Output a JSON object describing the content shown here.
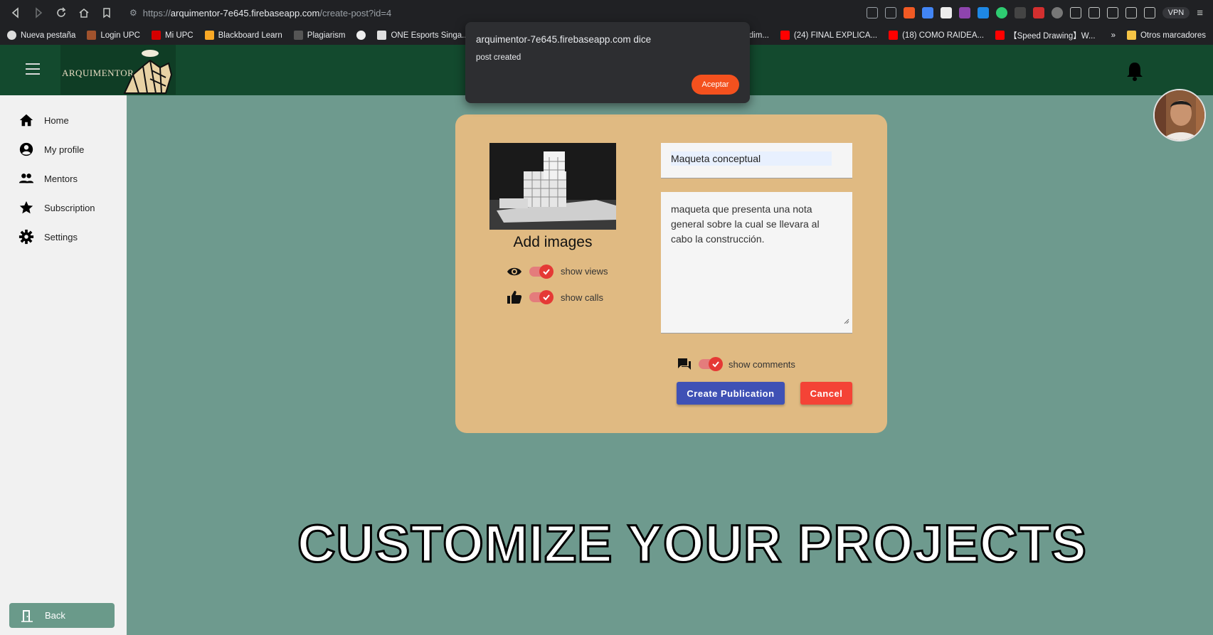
{
  "browser": {
    "url_protocol": "https://",
    "url_host": "arquimentor-7e645.firebaseapp.com",
    "url_path": "/create-post?id=4",
    "vpn_label": "VPN",
    "bookmarks": [
      "Nueva pestaña",
      "Login UPC",
      "Mi UPC",
      "Blackboard Learn",
      "Plagiarism",
      "",
      "ONE Esports Singa..."
    ],
    "bookmarks_right": [
      "endim...",
      "(24) FINAL EXPLICA...",
      "(18) COMO RAIDEA...",
      "【Speed Drawing】W..."
    ],
    "overflow_label": "»",
    "other_bookmarks": "Otros marcadores"
  },
  "header": {
    "logo_text": "ARQUIMENTOR"
  },
  "sidebar": {
    "items": [
      {
        "label": "Home",
        "icon": "home-icon"
      },
      {
        "label": "My profile",
        "icon": "account-circle-icon"
      },
      {
        "label": "Mentors",
        "icon": "people-icon"
      },
      {
        "label": "Subscription",
        "icon": "star-icon"
      },
      {
        "label": "Settings",
        "icon": "gear-icon"
      }
    ],
    "back_label": "Back"
  },
  "form": {
    "add_images_label": "Add images",
    "show_views_label": "show views",
    "show_calls_label": "show calls",
    "show_comments_label": "show comments",
    "show_views": true,
    "show_calls": true,
    "show_comments": true,
    "title_value": "Maqueta conceptual",
    "description_value": "maqueta que presenta una nota general sobre la cual se llevara al cabo la construcción.",
    "create_label": "Create Publication",
    "cancel_label": "Cancel",
    "colors": {
      "card": "#e0ba82",
      "create": "#3f51b5",
      "cancel": "#f44336",
      "toggle": "#e53935"
    }
  },
  "dialog": {
    "title": "arquimentor-7e645.firebaseapp.com dice",
    "message": "post created",
    "ok_label": "Aceptar"
  },
  "banner": {
    "text": "CUSTOMIZE YOUR PROJECTS"
  }
}
